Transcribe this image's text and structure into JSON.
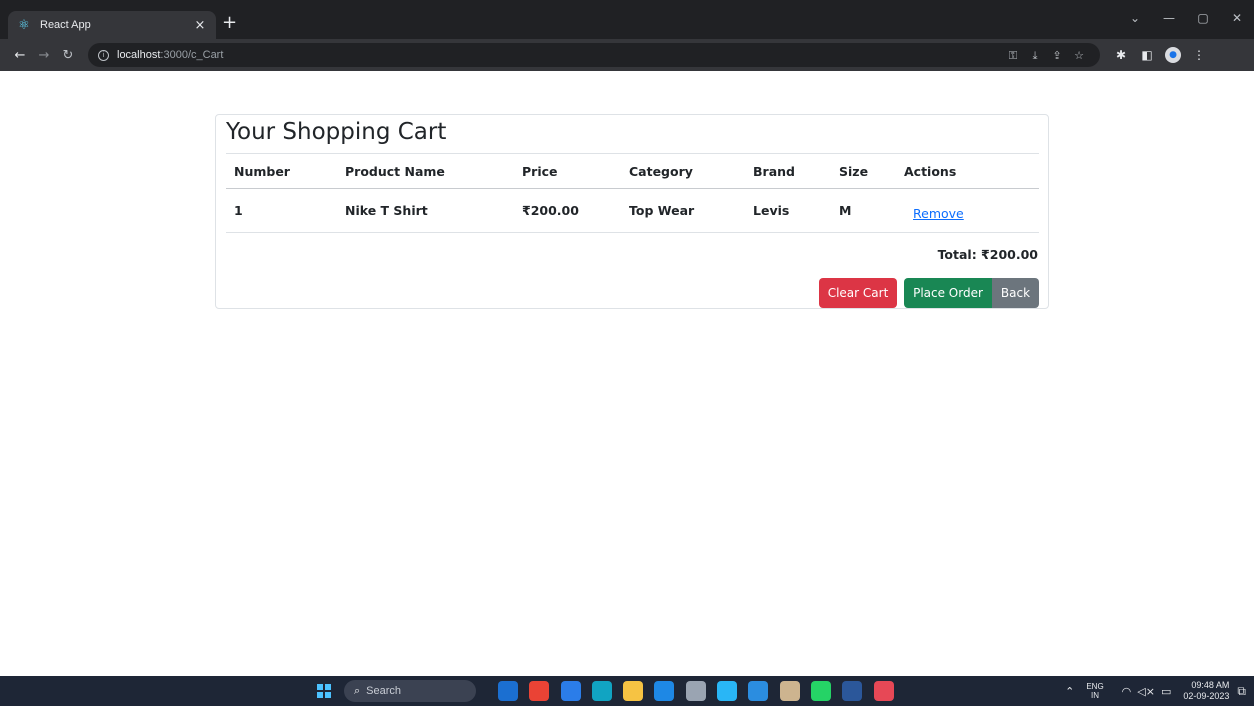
{
  "browser": {
    "tab_title": "React App",
    "tab_close": "×",
    "new_tab": "+",
    "url_host": "localhost",
    "url_path": ":3000/c_Cart",
    "window_controls": [
      "⌄",
      "—",
      "▢",
      "✕"
    ]
  },
  "cart": {
    "title": "Your Shopping Cart",
    "columns": [
      "Number",
      "Product Name",
      "Price",
      "Category",
      "Brand",
      "Size",
      "Actions"
    ],
    "rows": [
      {
        "number": "1",
        "product_name": "Nike T Shirt",
        "price": "₹200.00",
        "category": "Top Wear",
        "brand": "Levis",
        "size": "M",
        "action": "Remove"
      }
    ],
    "total_label": "Total: ₹200.00",
    "buttons": {
      "clear": "Clear Cart",
      "order": "Place Order",
      "back": "Back"
    }
  },
  "taskbar": {
    "search_label": "Search",
    "apps": [
      {
        "name": "bing-icon",
        "color": "#1b6fd1"
      },
      {
        "name": "chrome-icon",
        "color": "#ea4335"
      },
      {
        "name": "store-icon",
        "color": "#2b7de9"
      },
      {
        "name": "edge-icon",
        "color": "#11a4c2"
      },
      {
        "name": "file-explorer-icon",
        "color": "#f6c343"
      },
      {
        "name": "app-l-icon",
        "color": "#1e88e5"
      },
      {
        "name": "settings-icon",
        "color": "#9aa4b2"
      },
      {
        "name": "monitor-icon",
        "color": "#29b6f6"
      },
      {
        "name": "vscode-icon",
        "color": "#2b8de0"
      },
      {
        "name": "gear-app-icon",
        "color": "#cdb48f"
      },
      {
        "name": "whatsapp-icon",
        "color": "#25d366"
      },
      {
        "name": "word-icon",
        "color": "#2b579a"
      },
      {
        "name": "snipping-icon",
        "color": "#e74856"
      }
    ],
    "lang_top": "ENG",
    "lang_bottom": "IN",
    "time": "09:48 AM",
    "date": "02-09-2023"
  }
}
